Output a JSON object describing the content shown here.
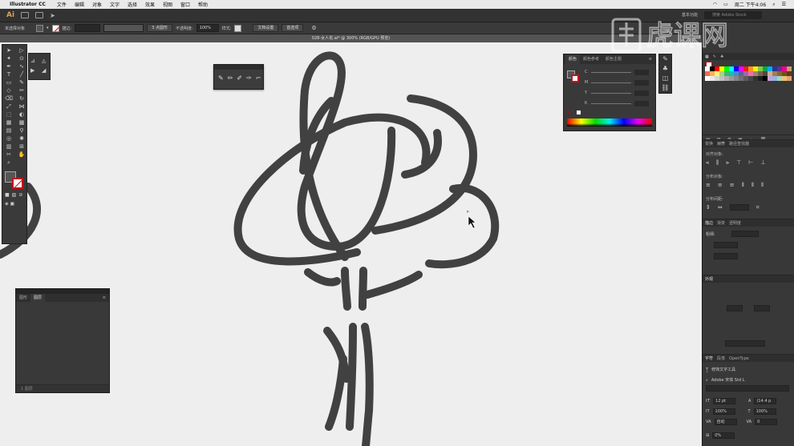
{
  "menubar": {
    "app": "Illustrator CC",
    "items": [
      "文件",
      "编辑",
      "对象",
      "文字",
      "选择",
      "效果",
      "视图",
      "窗口",
      "帮助"
    ],
    "clock": "周二 下午4:06"
  },
  "appbar": {
    "logo": "Ai",
    "workspace": "基本功能",
    "search_placeholder": "搜索 Adobe Stock"
  },
  "controlbar": {
    "selection": "未选择对象",
    "stroke_label": "描边:",
    "brush": "3 点圆形",
    "opacity_label": "不透明度:",
    "opacity": "100%",
    "style_label": "样式:",
    "doc_setup": "文档设置",
    "prefs": "首选项"
  },
  "document": {
    "tab_title": "028-女人花.ai* @ 300% (RGB/GPU 预览)"
  },
  "layers_panel": {
    "tabs": [
      "图形",
      "图层"
    ],
    "footer": "1 图层"
  },
  "color_panel": {
    "tabs": [
      "颜色",
      "颜色参考",
      "颜色主题"
    ],
    "channels": [
      "C",
      "M",
      "Y",
      "K"
    ]
  },
  "right_dock": {
    "align_tabs": [
      "变换",
      "对齐",
      "路径查找器"
    ],
    "align_objects_label": "对齐对象:",
    "distribute_objects_label": "分布对象:",
    "distribute_spacing_label": "分布间距:",
    "stroke_tabs": [
      "描边",
      "渐变",
      "透明度"
    ],
    "weight_label": "粗细:",
    "appearance_title": "外观",
    "char_tabs": [
      "字符",
      "段落",
      "OpenType"
    ],
    "touch_type": "修饰文字工具",
    "font_name": "Adobe 宋体 Std L",
    "font_size": "12 pt",
    "leading": "(14.4 p",
    "h_scale": "100%",
    "v_scale": "100%",
    "kerning": "自动",
    "tracking": "0",
    "rotation": "0%"
  },
  "watermark": {
    "text": "虎课网"
  },
  "colors": {
    "canvas": "#eeeeee",
    "stroke_art": "#414141",
    "panel_bg": "#383838",
    "accent_red": "#c3121d"
  },
  "swatches": [
    "#ffffff",
    "#000000",
    "#ff0000",
    "#ffff00",
    "#00ff00",
    "#00ffff",
    "#0000ff",
    "#ff00ff",
    "#ed1c24",
    "#f7941d",
    "#fff200",
    "#8dc63f",
    "#00a651",
    "#00aeef",
    "#2e3192",
    "#662d91",
    "#ec008c",
    "#c69c6d",
    "#f26c4f",
    "#fbaf5d",
    "#fff568",
    "#acd373",
    "#3cb878",
    "#1cbbb4",
    "#448ccb",
    "#605ca8",
    "#a864a8",
    "#f06eaa",
    "#998675",
    "#736357",
    "#534741",
    "#c7b299",
    "#a67c52",
    "#8c6239",
    "#754c24",
    "#603913",
    "#ffffff",
    "#ebebeb",
    "#d6d6d6",
    "#c2c2c2",
    "#adadad",
    "#999999",
    "#858585",
    "#707070",
    "#5c5c5c",
    "#474747",
    "#333333",
    "#1f1f1f",
    "#000000",
    "#c9a0dc",
    "#8fb8de",
    "#9ed8c6",
    "#e6c76d",
    "#e79e7b"
  ]
}
